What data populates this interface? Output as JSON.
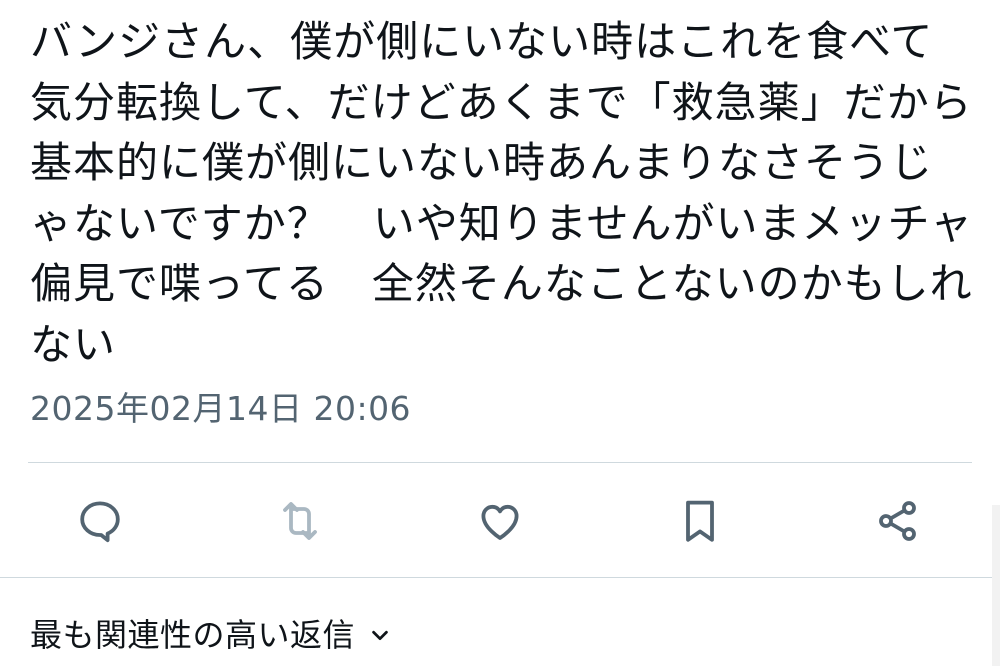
{
  "tweet": {
    "text": "バンジさん、僕が側にいない時はこれを食べて気分転換して、だけどあくまで「救急薬」だから基本的に僕が側にいない時あんまりなさそうじゃないですか？　いや知りませんがいまメッチャ偏見で喋ってる　全然そんなことないのかもしれない",
    "timestamp": "2025年02月14日 20:06"
  },
  "actions": [
    {
      "name": "reply",
      "icon": "speech-bubble-icon"
    },
    {
      "name": "retweet",
      "icon": "retweet-arrows-icon"
    },
    {
      "name": "like",
      "icon": "heart-icon"
    },
    {
      "name": "bookmark",
      "icon": "bookmark-icon"
    },
    {
      "name": "share",
      "icon": "share-nodes-icon"
    }
  ],
  "replies": {
    "sort_label": "最も関連性の高い返信",
    "chevron_icon": "chevron-down-icon"
  },
  "colors": {
    "text": "#0f1419",
    "muted": "#536471",
    "icon": "#536471",
    "divider": "#cfd9de"
  }
}
